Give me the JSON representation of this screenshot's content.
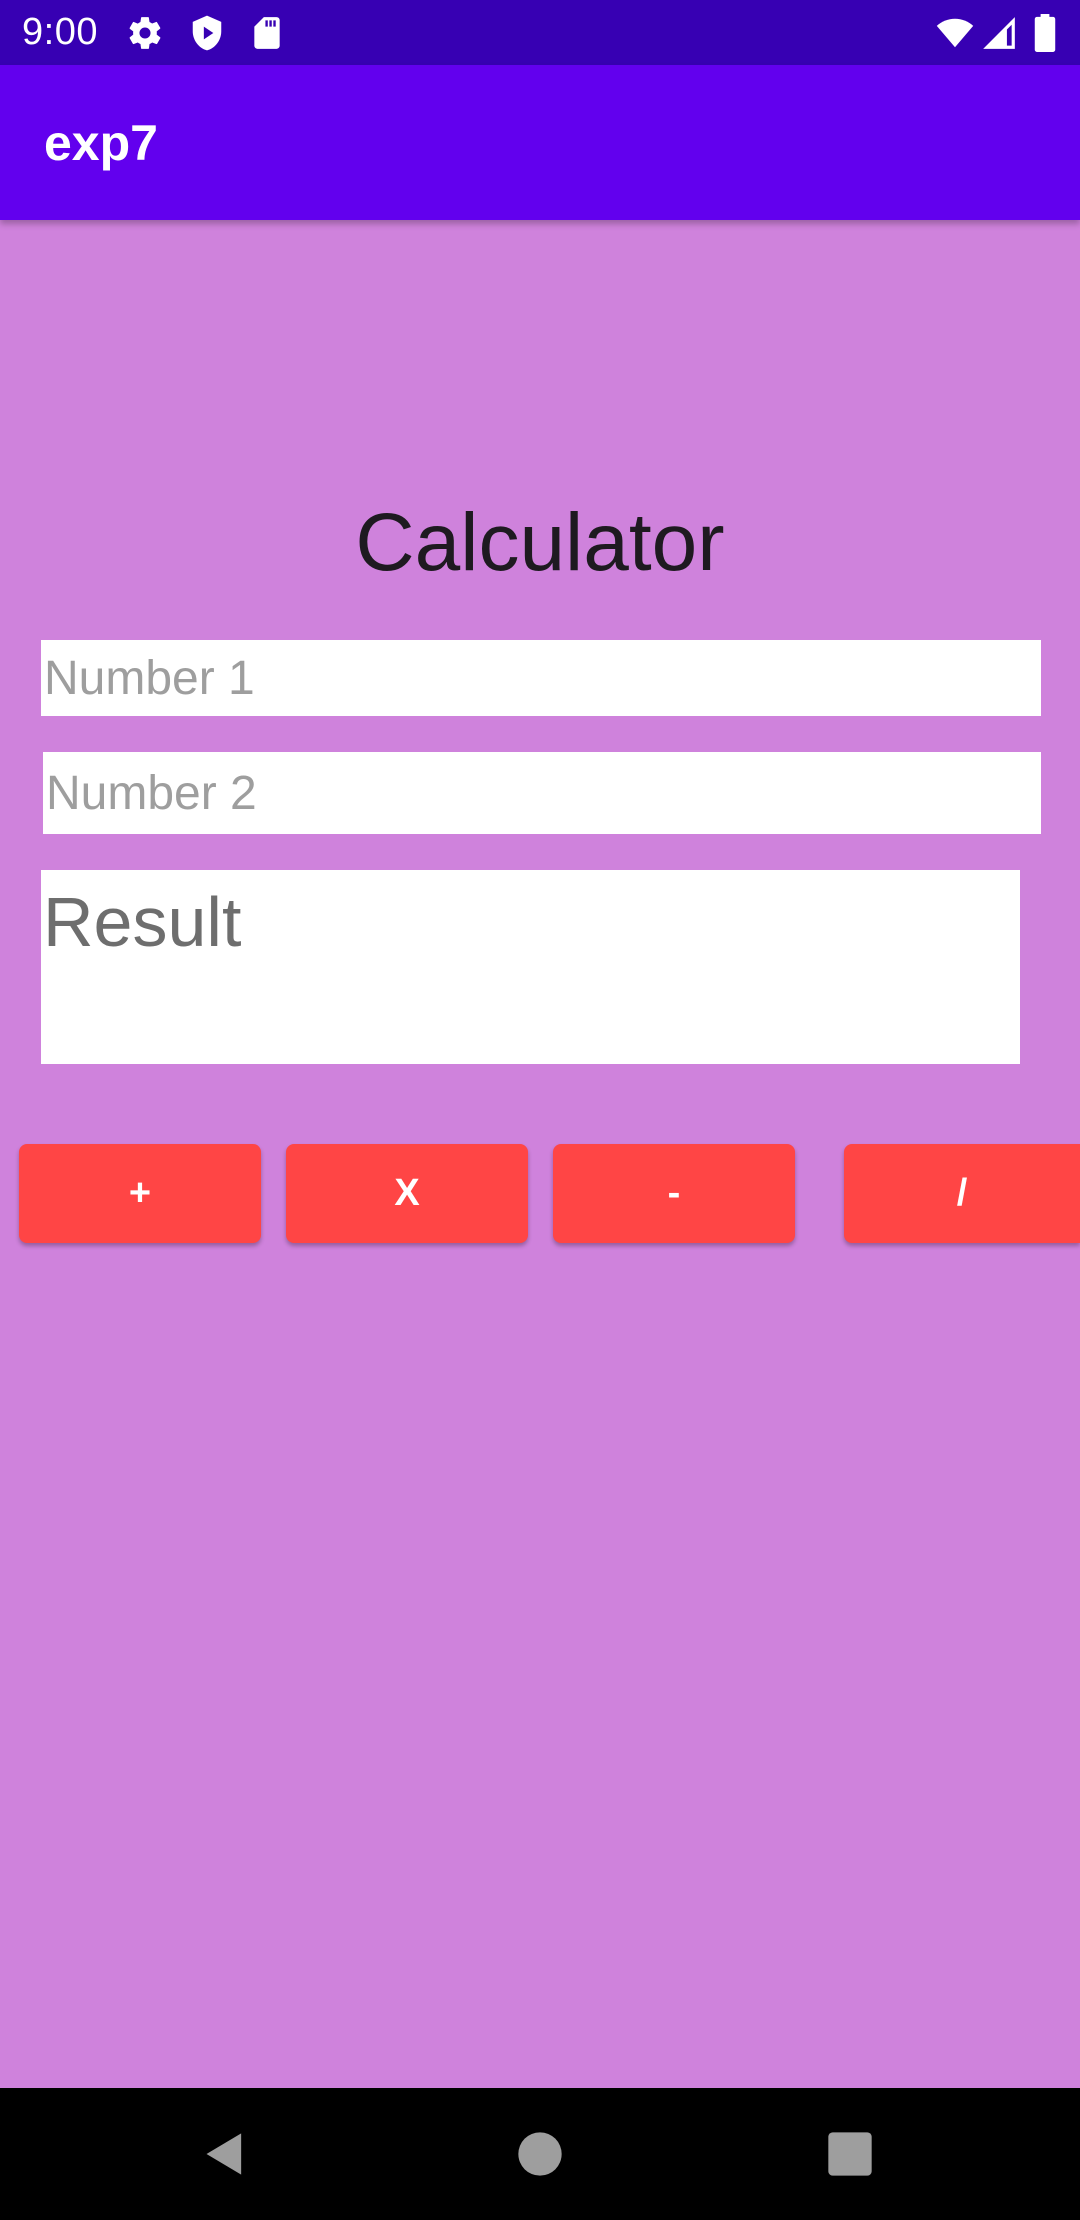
{
  "status_bar": {
    "time": "9:00",
    "left_icons": [
      "gear-icon",
      "play-protect-icon",
      "sd-card-icon"
    ],
    "right_icons": [
      "wifi-icon",
      "cellular-signal-icon",
      "battery-icon"
    ]
  },
  "app_bar": {
    "title": "exp7"
  },
  "main": {
    "heading": "Calculator",
    "number1": {
      "placeholder": "Number 1",
      "value": ""
    },
    "number2": {
      "placeholder": "Number 2",
      "value": ""
    },
    "result": "Result"
  },
  "buttons": {
    "add": "+",
    "multiply": "X",
    "subtract": "-",
    "divide": "/"
  },
  "nav_bar": {
    "icons": [
      "back-icon",
      "home-icon",
      "recents-icon"
    ]
  },
  "colors": {
    "status_bar": "#3700B3",
    "app_bar": "#6200EE",
    "background": "#CF82DC",
    "button": "#FF4545"
  }
}
